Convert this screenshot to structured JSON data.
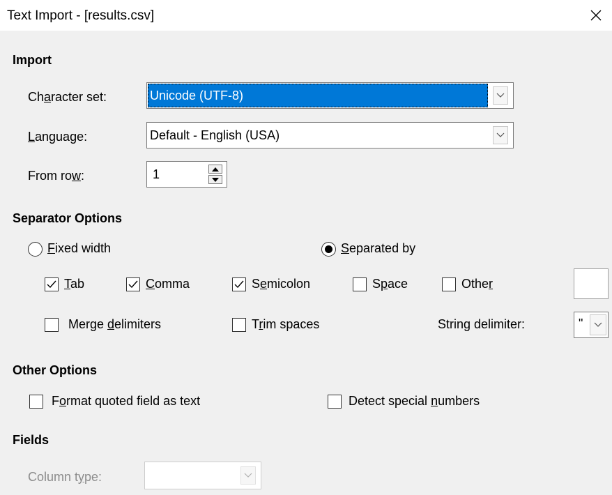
{
  "window": {
    "title": "Text Import - [results.csv]"
  },
  "import": {
    "heading": "Import",
    "charset": {
      "label_pre": "Ch",
      "label_key": "a",
      "label_post": "racter set:",
      "value": "Unicode (UTF-8)"
    },
    "language": {
      "label_key": "L",
      "label_post": "anguage:",
      "value": "Default - English (USA)"
    },
    "from_row": {
      "label_pre": "From ro",
      "label_key": "w",
      "label_post": ":",
      "value": "1"
    }
  },
  "separator": {
    "heading": "Separator Options",
    "fixed_width": {
      "key": "F",
      "rest": "ixed width",
      "selected": false
    },
    "separated_by": {
      "key": "S",
      "rest": "eparated by",
      "selected": true
    },
    "tab": {
      "key": "T",
      "rest": "ab",
      "checked": true
    },
    "comma": {
      "key": "C",
      "rest": "omma",
      "checked": true
    },
    "semicolon": {
      "pre": "S",
      "key": "e",
      "rest": "micolon",
      "checked": true
    },
    "space": {
      "pre": "S",
      "key": "p",
      "rest": "ace",
      "checked": false
    },
    "other": {
      "pre": "Othe",
      "key": "r",
      "rest": "",
      "checked": false,
      "value": ""
    },
    "merge": {
      "pre": "Merge ",
      "key": "d",
      "rest": "elimiters",
      "checked": false
    },
    "trim": {
      "pre": "T",
      "key": "r",
      "rest": "im spaces",
      "checked": false
    },
    "string_delimiter": {
      "pre": "Strin",
      "key": "g",
      "rest": " delimiter:",
      "value": "\""
    }
  },
  "other_options": {
    "heading": "Other Options",
    "quoted": {
      "pre": "F",
      "key": "o",
      "rest": "rmat quoted field as text",
      "checked": false
    },
    "special": {
      "pre": "Detect special ",
      "key": "n",
      "rest": "umbers",
      "checked": false
    }
  },
  "fields": {
    "heading": "Fields",
    "column_type": {
      "pre": "Column t",
      "key": "y",
      "rest": "pe:",
      "value": ""
    }
  },
  "colors": {
    "selection": "#0078d7",
    "background": "#f0f0f0"
  }
}
